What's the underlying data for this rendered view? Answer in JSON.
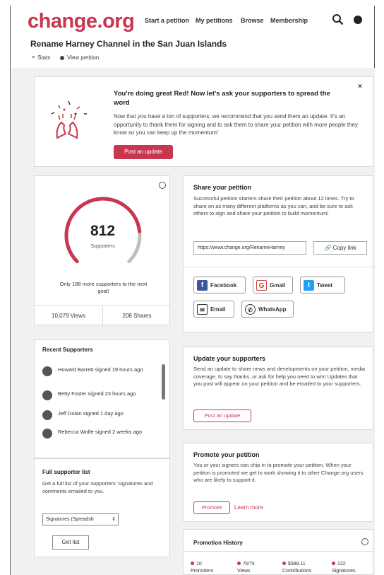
{
  "header": {
    "logo": "change.org",
    "nav": [
      "Start a petition",
      "My petitions",
      "Browse",
      "Membership"
    ]
  },
  "petition": {
    "title": "Rename Harney Channel in the San Juan Islands",
    "subnav": [
      "Stats",
      "View petition"
    ]
  },
  "banner": {
    "title": "You're doing great Red! Now let's ask your supporters to spread the word",
    "text": "Now that you have a ton of supporters, we recommend that you send them an update. It's an opportunity to thank them for signing and to ask them to share your petition with more people they know so you can keep up the momentum!",
    "button": "Post an update",
    "close": "×"
  },
  "supporters": {
    "count": "812",
    "label": "Supporters",
    "goal_text": "Only 188 more supporters to the next goal!",
    "progress": 0.81,
    "views": "10,079 Views",
    "shares": "208 Shares"
  },
  "share": {
    "title": "Share your petition",
    "text": "Successful petition starters share their petition about 12 times. Try to share on as many different platforms as you can, and be sure to ask others to sign and share your petition to build momentum!",
    "url": "https://www.change.org/RenameHarney",
    "copy_button": "Copy link",
    "buttons": {
      "facebook": "Facebook",
      "gmail": "Gmail",
      "tweet": "Tweet",
      "email": "Email",
      "whatsapp": "WhatsApp"
    }
  },
  "recent": {
    "title": "Recent Supporters",
    "items": [
      "Howard Barrett signed 19 hours ago",
      "Betty Foster signed 23 hours ago",
      "Jeff Dolan signed 1 day ago",
      "Rebecca Wolfe signed 2 weeks ago"
    ]
  },
  "fulllist": {
    "title": "Full supporter list",
    "text": "Get a full list of your supporters' signatures and comments emailed to you.",
    "select_value": "Signatures (Spreadsh",
    "button": "Get list"
  },
  "update": {
    "title": "Update your supporters",
    "text": "Send an update to share news and developments on your petition, media coverage, to say thanks, or ask for help you need to win! Updates that you post will appear on your petition and be emailed to your supporters.",
    "button": "Post an update"
  },
  "promote": {
    "title": "Promote your petition",
    "text": "You or your signers can chip in to promote your petition. When your petition is promoted we get to work showing it to other Change.org users who are likely to support it.",
    "button": "Promote",
    "learn": "Learn more"
  },
  "history": {
    "title": "Promotion History",
    "stats": [
      {
        "value": "10",
        "label": "Promoters"
      },
      {
        "value": "7k/7k",
        "label": "Views"
      },
      {
        "value": "$388.11",
        "label": "Contributions"
      },
      {
        "value": "122",
        "label": "Signatures"
      }
    ]
  },
  "colors": {
    "brand": "#c8364f",
    "gauge_track": "#bfbfbf"
  }
}
